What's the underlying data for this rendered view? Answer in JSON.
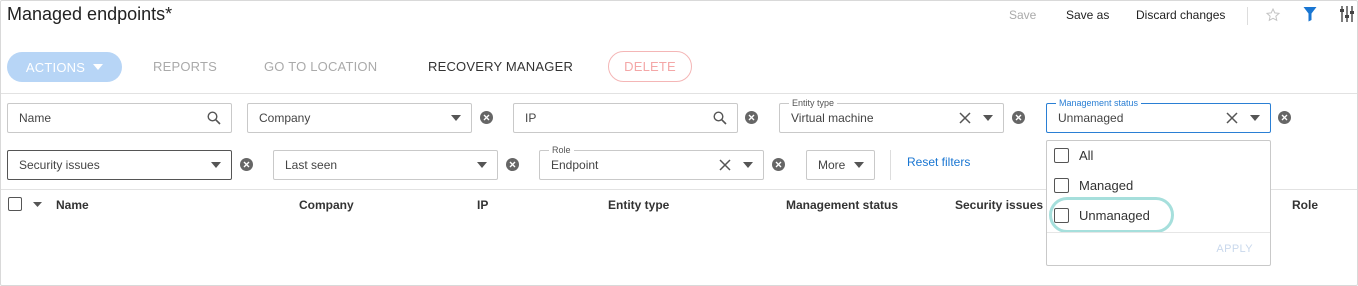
{
  "page": {
    "title": "Managed endpoints*"
  },
  "top_actions": {
    "save": "Save",
    "save_as": "Save as",
    "discard": "Discard changes"
  },
  "icons": {
    "star": "star-outline-icon",
    "filter": "filter-icon",
    "columns": "sliders-icon"
  },
  "toolbar": {
    "actions": "ACTIONS",
    "reports": "REPORTS",
    "go_to_location": "GO TO LOCATION",
    "recovery_manager": "RECOVERY MANAGER",
    "delete": "DELETE"
  },
  "filters": {
    "name": {
      "placeholder": "Name"
    },
    "company": {
      "value": "Company"
    },
    "ip": {
      "placeholder": "IP"
    },
    "entity_type": {
      "label": "Entity type",
      "value": "Virtual machine"
    },
    "management_status": {
      "label": "Management status",
      "value": "Unmanaged"
    },
    "security_issues": {
      "value": "Security issues"
    },
    "last_seen": {
      "value": "Last seen"
    },
    "role": {
      "label": "Role",
      "value": "Endpoint"
    },
    "more": "More",
    "reset": "Reset filters"
  },
  "table": {
    "columns": [
      "Name",
      "Company",
      "IP",
      "Entity type",
      "Management status",
      "Security issues",
      "Role"
    ]
  },
  "dropdown": {
    "options": [
      "All",
      "Managed",
      "Unmanaged"
    ],
    "apply": "APPLY"
  },
  "colors": {
    "accent": "#1976d2",
    "actions_bg": "#b7d5f6",
    "delete_border": "#f4b6b6",
    "highlight": "#a6dfdc"
  }
}
